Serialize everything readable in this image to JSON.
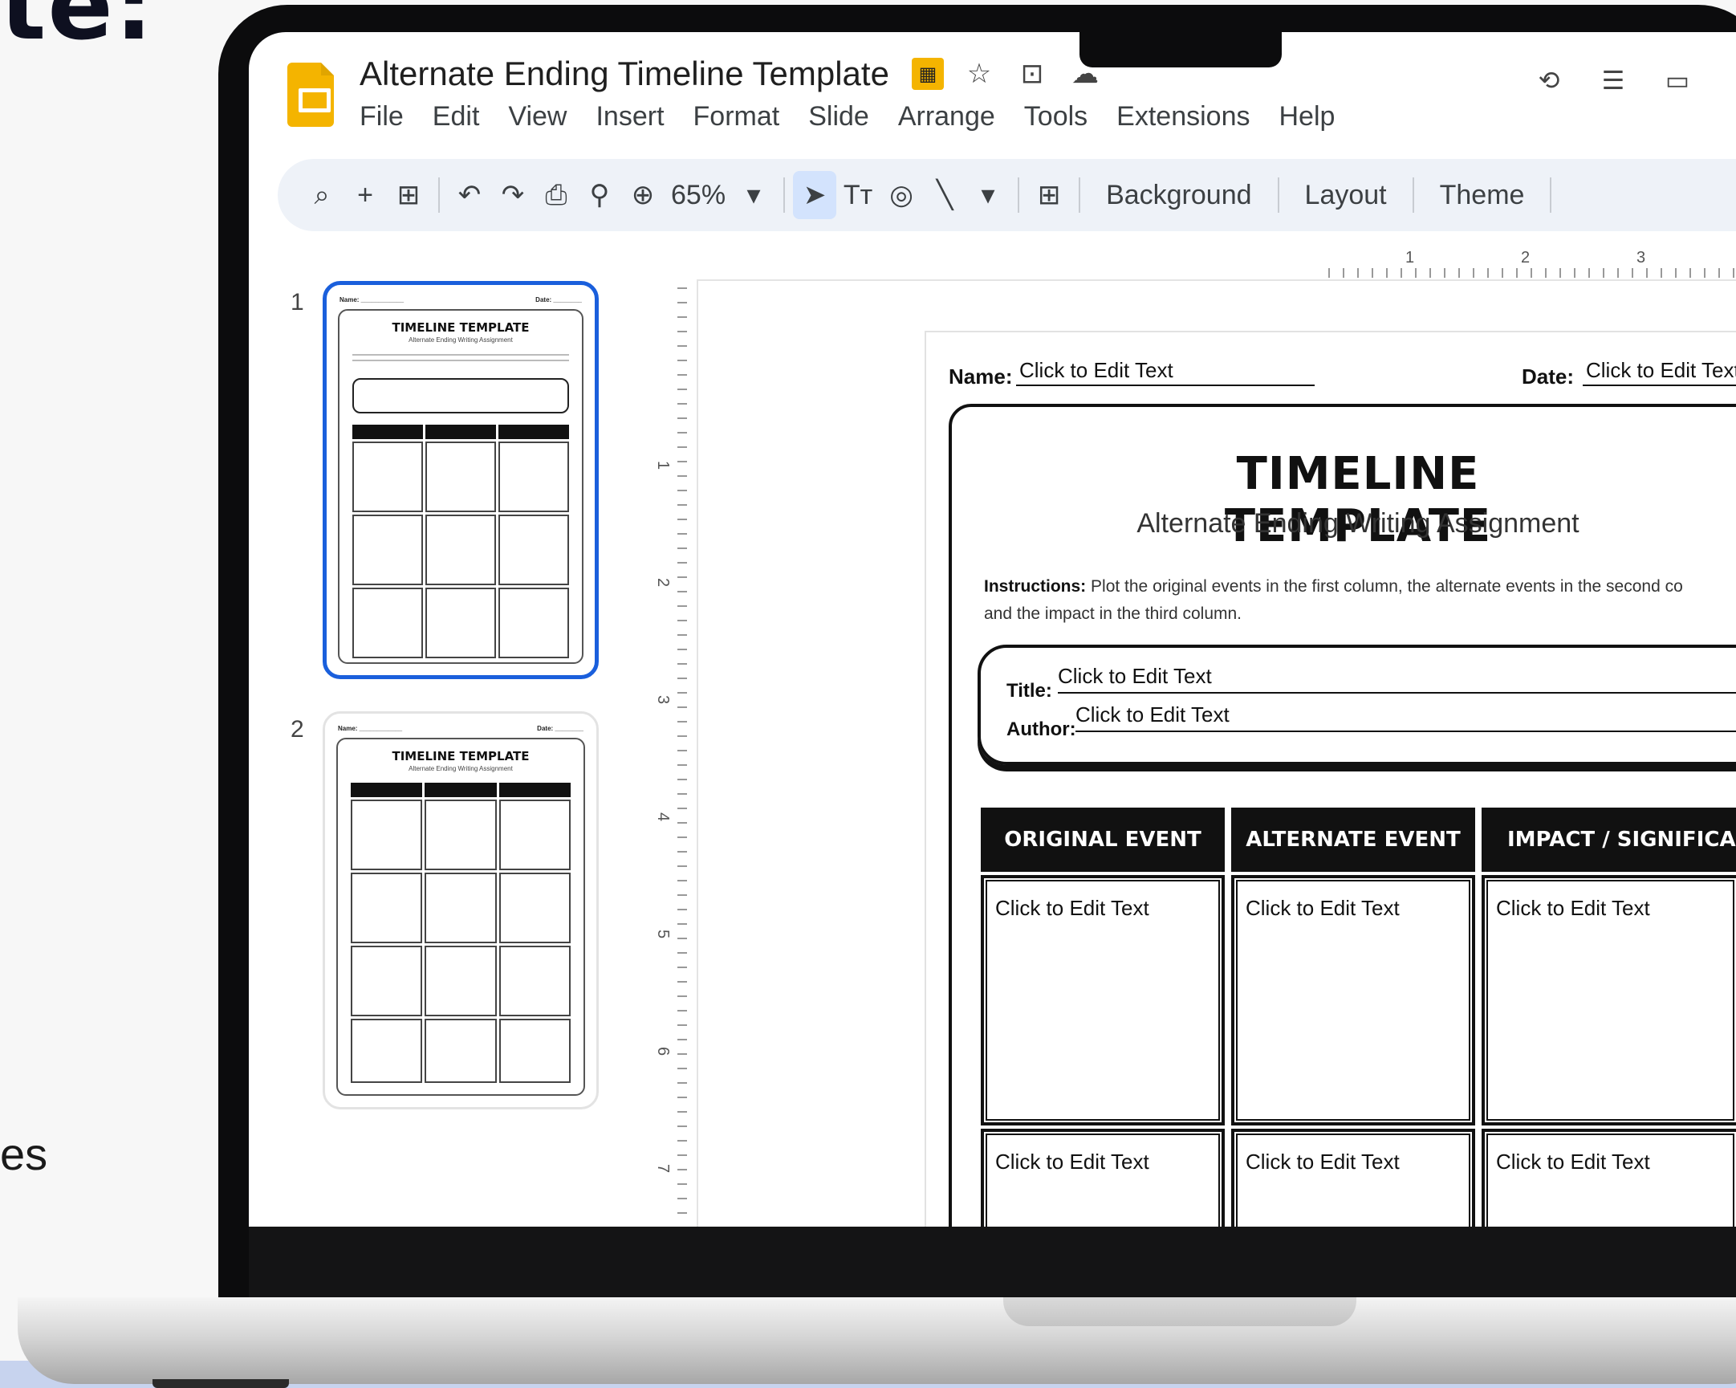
{
  "background": {
    "headline": "te:",
    "footer_fragment": "es"
  },
  "app": {
    "doc_title": "Alternate Ending Timeline Template",
    "menus": [
      "File",
      "Edit",
      "View",
      "Insert",
      "Format",
      "Slide",
      "Arrange",
      "Tools",
      "Extensions",
      "Help"
    ]
  },
  "toolbar": {
    "zoom": "65%",
    "background_label": "Background",
    "layout_label": "Layout",
    "theme_label": "Theme"
  },
  "ruler": {
    "horizontal": [
      "1",
      "2",
      "3"
    ],
    "vertical": [
      "1",
      "2",
      "3",
      "4",
      "5",
      "6",
      "7"
    ]
  },
  "filmstrip": {
    "slides": [
      {
        "number": "1",
        "title": "TIMELINE TEMPLATE",
        "selected": true
      },
      {
        "number": "2",
        "title": "TIMELINE TEMPLATE",
        "selected": false
      }
    ]
  },
  "slide": {
    "name_label": "Name:",
    "name_value": "Click to Edit Text",
    "date_label": "Date:",
    "date_value": "Click to Edit Text",
    "title": "TIMELINE TEMPLATE",
    "subtitle": "Alternate Ending Writing Assignment",
    "instructions_label": "Instructions:",
    "instructions_text": "Plot the original events in the first column, the alternate events in the second co",
    "instructions_text_2": "and the impact in the third column.",
    "title_label": "Title:",
    "title_value": "Click to Edit Text",
    "author_label": "Author:",
    "author_value": "Click to Edit Text",
    "columns": [
      "ORIGINAL EVENT",
      "ALTERNATE EVENT",
      "IMPACT / SIGNIFICAN"
    ],
    "rows": [
      [
        "Click to Edit Text",
        "Click to Edit Text",
        "Click to Edit Text"
      ],
      [
        "Click to Edit Text",
        "Click to Edit Text",
        "Click to Edit Text"
      ]
    ]
  },
  "colors": {
    "accent": "#1a5fdc",
    "logo": "#f4b400",
    "toolbar_bg": "#eef2f8"
  }
}
